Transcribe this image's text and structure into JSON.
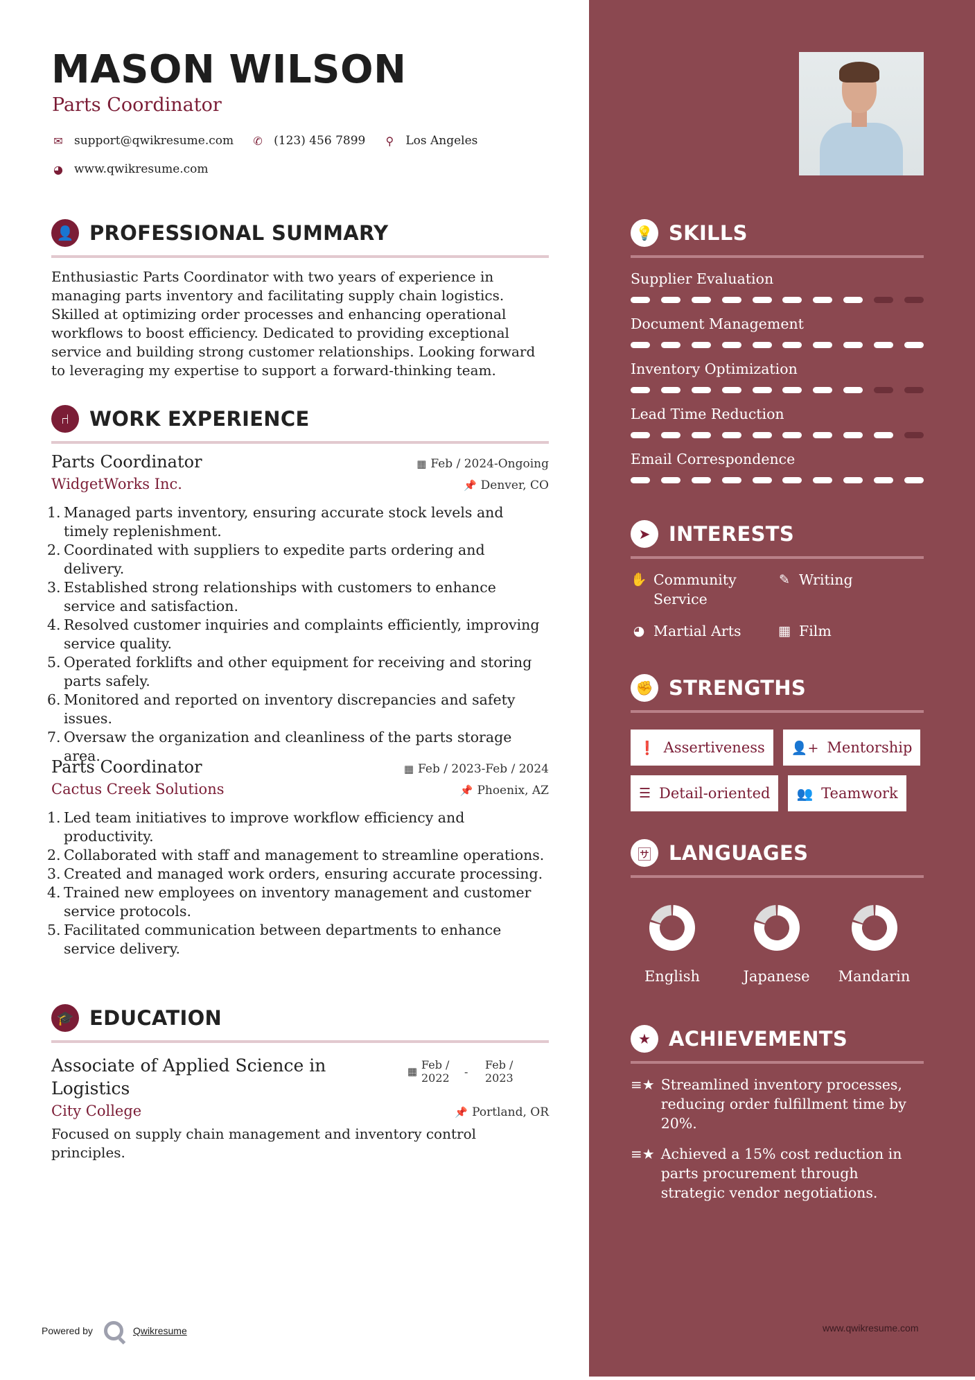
{
  "header": {
    "name": "MASON WILSON",
    "role": "Parts Coordinator",
    "contact": {
      "email": "support@qwikresume.com",
      "phone": "(123) 456 7899",
      "location": "Los Angeles",
      "website": "www.qwikresume.com"
    },
    "icons": {
      "email": "envelope-icon",
      "phone": "phone-icon",
      "location": "map-marker-icon",
      "website": "globe-icon"
    }
  },
  "summary": {
    "title": "PROFESSIONAL SUMMARY",
    "icon": "user-icon",
    "text": "Enthusiastic Parts Coordinator with two years of experience in managing parts inventory and facilitating supply chain logistics. Skilled at optimizing order processes and enhancing operational workflows to boost efficiency. Dedicated to providing exceptional service and building strong customer relationships. Looking forward to leveraging my expertise to support a forward-thinking team."
  },
  "work": {
    "title": "WORK EXPERIENCE",
    "icon": "office-chair-icon",
    "jobs": [
      {
        "title": "Parts Coordinator",
        "company": "WidgetWorks Inc.",
        "dates": "Feb / 2024-Ongoing",
        "location": "Denver, CO",
        "bullets": [
          "Managed parts inventory, ensuring accurate stock levels and timely replenishment.",
          "Coordinated with suppliers to expedite parts ordering and delivery.",
          "Established strong relationships with customers to enhance service and satisfaction.",
          "Resolved customer inquiries and complaints efficiently, improving service quality.",
          "Operated forklifts and other equipment for receiving and storing parts safely.",
          "Monitored and reported on inventory discrepancies and safety issues.",
          "Oversaw the organization and cleanliness of the parts storage area."
        ]
      },
      {
        "title": "Parts Coordinator",
        "company": "Cactus Creek Solutions",
        "dates": "Feb / 2023-Feb / 2024",
        "location": "Phoenix, AZ",
        "bullets": [
          "Led team initiatives to improve workflow efficiency and productivity.",
          "Collaborated with staff and management to streamline operations.",
          "Created and managed work orders, ensuring accurate processing.",
          "Trained new employees on inventory management and customer service protocols.",
          "Facilitated communication between departments to enhance service delivery."
        ]
      }
    ]
  },
  "education": {
    "title": "EDUCATION",
    "icon": "graduate-icon",
    "degree": "Associate of Applied Science in Logistics",
    "school": "City College",
    "start": "Feb / 2022",
    "end": "Feb / 2023",
    "separator": "-",
    "location": "Portland, OR",
    "description": "Focused on supply chain management and inventory control principles."
  },
  "skills": {
    "title": "SKILLS",
    "icon": "lightbulb-icon",
    "scale_max": 10,
    "items": [
      {
        "name": "Supplier Evaluation",
        "level": 8
      },
      {
        "name": "Document Management",
        "level": 10
      },
      {
        "name": "Inventory Optimization",
        "level": 8
      },
      {
        "name": "Lead Time Reduction",
        "level": 9
      },
      {
        "name": "Email Correspondence",
        "level": 10
      }
    ]
  },
  "interests": {
    "title": "INTERESTS",
    "icon": "paper-plane-icon",
    "items": [
      {
        "label": "Community Service",
        "icon": "hand-icon",
        "glyph": "✋"
      },
      {
        "label": "Writing",
        "icon": "pencil-icon",
        "glyph": "✎"
      },
      {
        "label": "Martial Arts",
        "icon": "globe-icon",
        "glyph": "◕"
      },
      {
        "label": "Film",
        "icon": "film-icon",
        "glyph": "▦"
      }
    ]
  },
  "strengths": {
    "title": "STRENGTHS",
    "icon": "fist-icon",
    "items": [
      {
        "label": "Assertiveness",
        "icon": "exclamation-circle-icon",
        "glyph": "❗"
      },
      {
        "label": "Mentorship",
        "icon": "user-plus-icon",
        "glyph": "👤+"
      },
      {
        "label": "Detail-oriented",
        "icon": "list-icon",
        "glyph": "☰"
      },
      {
        "label": "Teamwork",
        "icon": "users-icon",
        "glyph": "👥"
      }
    ]
  },
  "languages": {
    "title": "LANGUAGES",
    "icon": "language-icon",
    "items": [
      {
        "name": "English",
        "proficiency": 0.8
      },
      {
        "name": "Japanese",
        "proficiency": 0.8
      },
      {
        "name": "Mandarin",
        "proficiency": 0.8
      }
    ],
    "colors": {
      "filled": "#ffffff",
      "empty": "#dcdcdc"
    }
  },
  "achievements": {
    "title": "ACHIEVEMENTS",
    "icon": "star-shooting-icon",
    "items": [
      "Streamlined inventory processes, reducing order fulfillment time by 20%.",
      "Achieved a 15% cost reduction in parts procurement through strategic vendor negotiations."
    ]
  },
  "footer": {
    "powered_by": "Powered by",
    "brand": "Qwikresume",
    "website": "www.qwikresume.com"
  },
  "colors": {
    "accent": "#7b1d36",
    "sidebar": "#8B4850",
    "left_rule": "#e2c9cf",
    "right_rule": "#b98088"
  }
}
